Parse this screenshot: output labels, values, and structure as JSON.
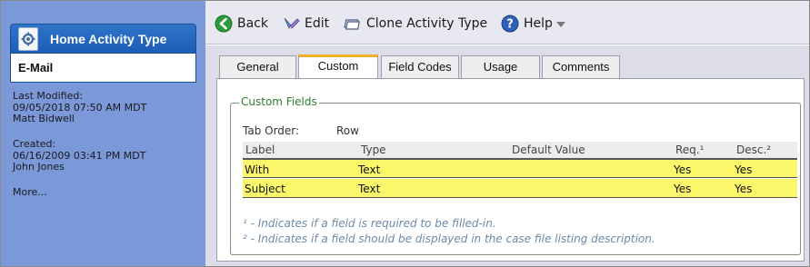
{
  "sidebar": {
    "header_title": "Home Activity Type",
    "header_icon": "gear-document-icon",
    "record_name": "E-Mail",
    "last_modified_label": "Last Modified:",
    "last_modified_date": "09/05/2018 07:50 AM MDT",
    "last_modified_user": "Matt Bidwell",
    "created_label": "Created:",
    "created_date": "06/16/2009 03:41 PM MDT",
    "created_user": "John Jones",
    "more_link": "More..."
  },
  "toolbar": {
    "back_label": "Back",
    "edit_label": "Edit",
    "clone_label": "Clone Activity Type",
    "help_label": "Help"
  },
  "tabs": [
    {
      "label": "General",
      "active": false
    },
    {
      "label": "Custom",
      "active": true
    },
    {
      "label": "Field Codes",
      "active": false
    },
    {
      "label": "Usage",
      "active": false
    },
    {
      "label": "Comments",
      "active": false
    }
  ],
  "custom_fields": {
    "legend": "Custom Fields",
    "tab_order_label": "Tab Order:",
    "tab_order_value": "Row",
    "columns": [
      "Label",
      "Type",
      "Default Value",
      "Req.¹",
      "Desc.²"
    ],
    "rows": [
      {
        "label": "With",
        "type": "Text",
        "default": "",
        "req": "Yes",
        "desc": "Yes"
      },
      {
        "label": "Subject",
        "type": "Text",
        "default": "",
        "req": "Yes",
        "desc": "Yes"
      }
    ],
    "footnote1": "¹ - Indicates if a field is required to be filled-in.",
    "footnote2": "² - Indicates if a field should be displayed in the case file listing description."
  },
  "colors": {
    "sidebar_bg": "#7b98d9",
    "header_blue": "#1d5eb6",
    "row_highlight": "#fbf76b",
    "active_tab_accent": "#f2b02a",
    "legend_green": "#2e7d32",
    "footnote_blue": "#6c8aa8"
  }
}
